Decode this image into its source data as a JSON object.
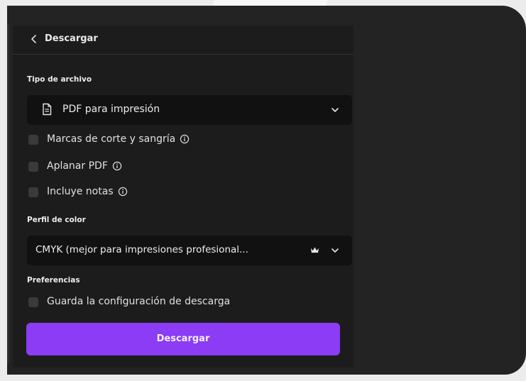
{
  "panel": {
    "title": "Descargar",
    "file_type": {
      "label": "Tipo de archivo",
      "selected": "PDF para impresión",
      "icon": "document-icon"
    },
    "options": [
      {
        "label": "Marcas de corte y sangría",
        "checked": false,
        "info": true
      },
      {
        "label": "Aplanar PDF",
        "checked": false,
        "info": true
      },
      {
        "label": "Incluye notas",
        "checked": false,
        "info": true
      }
    ],
    "color_profile": {
      "label": "Perfil de color",
      "selected": "CMYK (mejor para impresiones profesional...",
      "badge_icon": "crown-icon"
    },
    "preferences": {
      "label": "Preferencias",
      "save_settings": {
        "label": "Guarda la configuración de descarga",
        "checked": false
      }
    },
    "download_button": "Descargar"
  },
  "colors": {
    "accent": "#8b3cf4",
    "panel_bg": "#1c1c1c",
    "select_bg": "#111111"
  }
}
